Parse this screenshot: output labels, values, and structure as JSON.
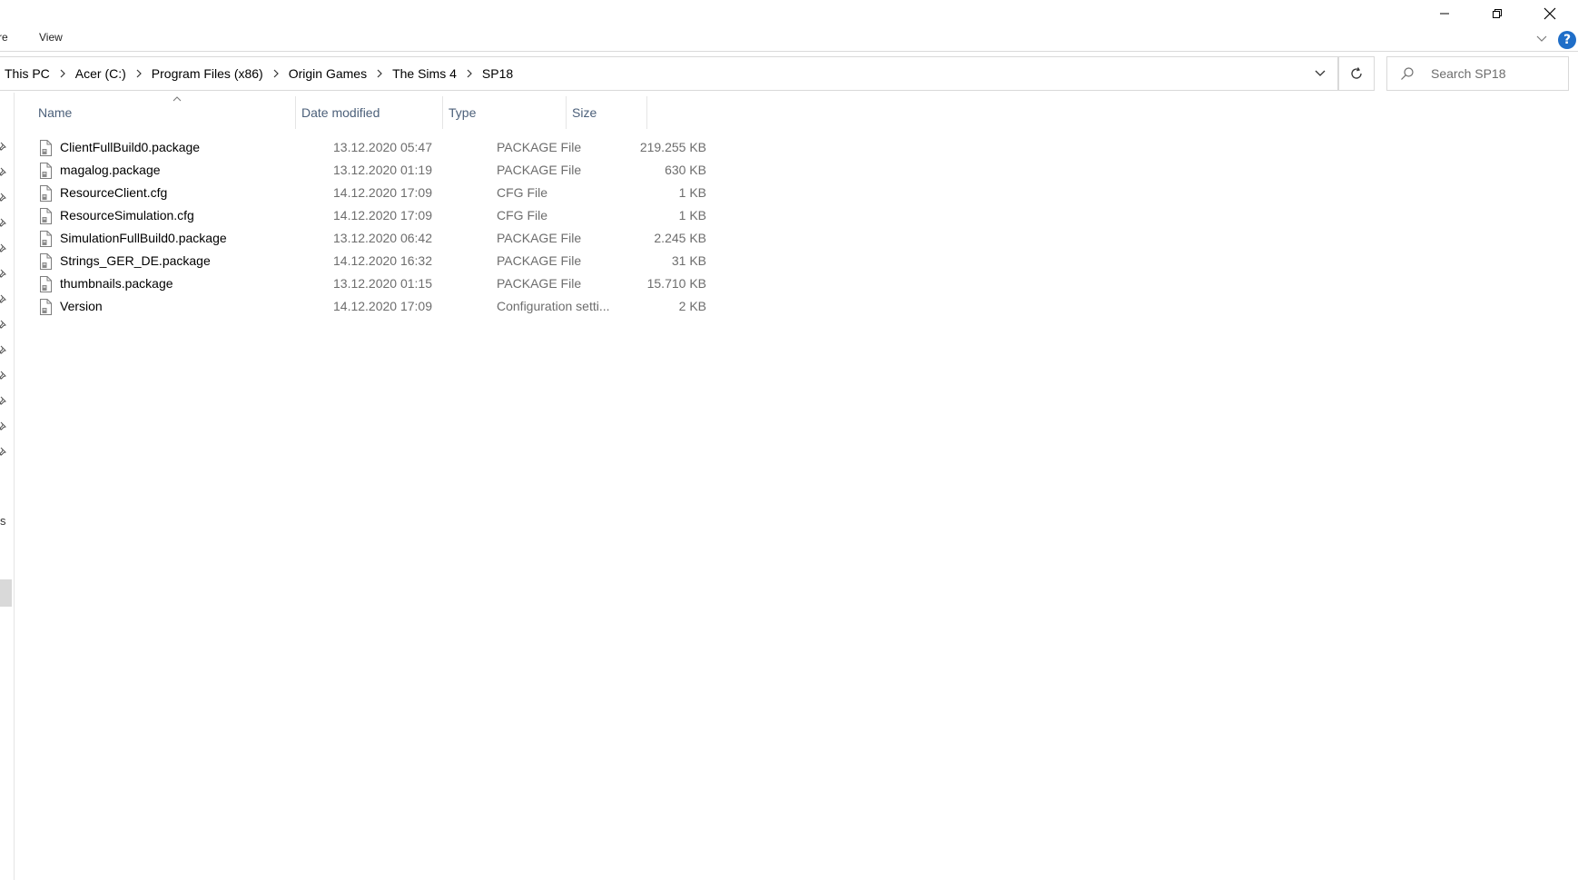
{
  "ribbon": {
    "tab_partial": "re",
    "tab_view": "View"
  },
  "window_controls": {
    "minimize_icon": "minimize-icon",
    "restore_icon": "restore-icon",
    "close_icon": "close-icon",
    "help_label": "?"
  },
  "address": {
    "crumbs": [
      "This PC",
      "Acer (C:)",
      "Program Files (x86)",
      "Origin Games",
      "The Sims 4",
      "SP18"
    ]
  },
  "search": {
    "placeholder": "Search SP18"
  },
  "nav_fragment": "s",
  "columns": {
    "name": "Name",
    "date": "Date modified",
    "type": "Type",
    "size": "Size"
  },
  "files": [
    {
      "name": "ClientFullBuild0.package",
      "date": "13.12.2020 05:47",
      "type": "PACKAGE File",
      "size": "219.255 KB"
    },
    {
      "name": "magalog.package",
      "date": "13.12.2020 01:19",
      "type": "PACKAGE File",
      "size": "630 KB"
    },
    {
      "name": "ResourceClient.cfg",
      "date": "14.12.2020 17:09",
      "type": "CFG File",
      "size": "1 KB"
    },
    {
      "name": "ResourceSimulation.cfg",
      "date": "14.12.2020 17:09",
      "type": "CFG File",
      "size": "1 KB"
    },
    {
      "name": "SimulationFullBuild0.package",
      "date": "13.12.2020 06:42",
      "type": "PACKAGE File",
      "size": "2.245 KB"
    },
    {
      "name": "Strings_GER_DE.package",
      "date": "14.12.2020 16:32",
      "type": "PACKAGE File",
      "size": "31 KB"
    },
    {
      "name": "thumbnails.package",
      "date": "13.12.2020 01:15",
      "type": "PACKAGE File",
      "size": "15.710 KB"
    },
    {
      "name": "Version",
      "date": "14.12.2020 17:09",
      "type": "Configuration setti...",
      "size": "2 KB"
    }
  ]
}
